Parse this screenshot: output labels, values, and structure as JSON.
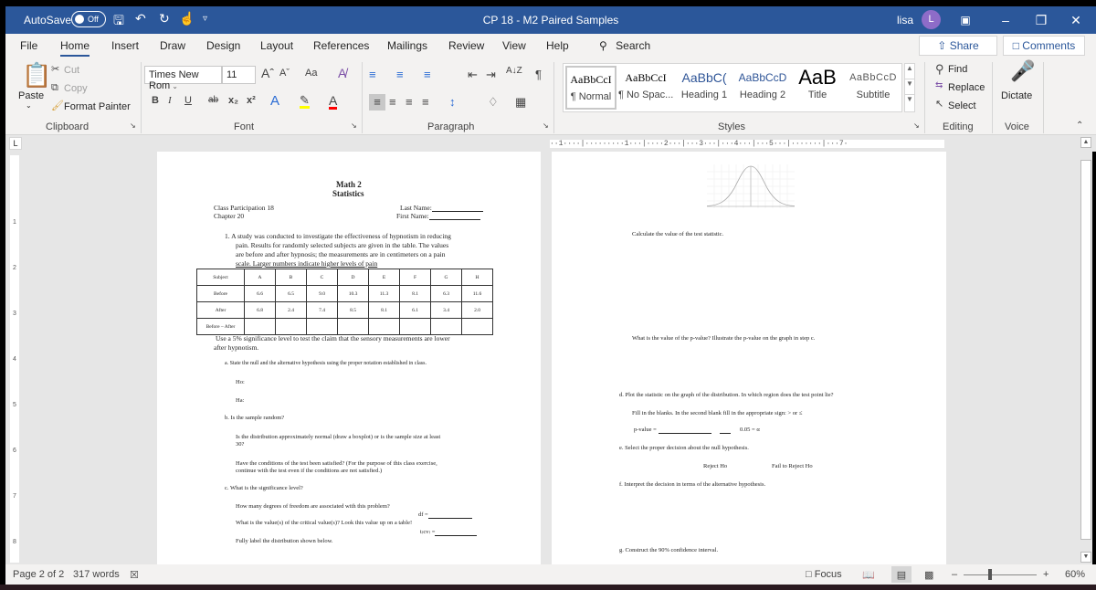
{
  "titlebar": {
    "autosave_label": "AutoSave",
    "autosave_state": "Off",
    "doc_title": "CP 18 - M2 Paired Samples",
    "user_name": "lisa",
    "user_initial": "L",
    "icons": [
      "save-icon",
      "undo-icon",
      "redo-icon",
      "touch-mode-icon",
      "customize-icon"
    ]
  },
  "menu": {
    "tabs": [
      "File",
      "Home",
      "Insert",
      "Draw",
      "Design",
      "Layout",
      "References",
      "Mailings",
      "Review",
      "View",
      "Help"
    ],
    "active_tab": "Home",
    "search_label": "Search",
    "share_label": "Share",
    "comments_label": "Comments"
  },
  "ribbon": {
    "clipboard": {
      "paste": "Paste",
      "cut": "Cut",
      "copy": "Copy",
      "format_painter": "Format Painter",
      "label": "Clipboard"
    },
    "font": {
      "font_name": "Times New Rom",
      "font_size": "11",
      "label": "Font",
      "grow": "Aˆ",
      "shrink": "Aˇ",
      "change_case": "Aa",
      "bold": "B",
      "italic": "I",
      "underline": "U",
      "strike": "ab",
      "subscript": "x₂",
      "superscript": "x²",
      "text_effects": "A",
      "font_color": "A",
      "highlight_color": "#ffff00",
      "font_color_value": "#ff0000"
    },
    "paragraph": {
      "label": "Paragraph",
      "pilcrow": "¶",
      "sort": "A↓Z"
    },
    "styles": {
      "label": "Styles",
      "items": [
        {
          "sample": "AaBbCcI",
          "name": "¶ Normal"
        },
        {
          "sample": "AaBbCcI",
          "name": "¶ No Spac..."
        },
        {
          "sample": "AaBbC(",
          "name": "Heading 1"
        },
        {
          "sample": "AaBbCcD",
          "name": "Heading 2"
        },
        {
          "sample": "AaB",
          "name": "Title"
        },
        {
          "sample": "AaBbCcD",
          "name": "Subtitle"
        }
      ]
    },
    "editing": {
      "label": "Editing",
      "find": "Find",
      "replace": "Replace",
      "select": "Select"
    },
    "voice": {
      "label": "Voice",
      "dictate": "Dictate"
    }
  },
  "ruler": {
    "horizontal": "··1····|·········1···|····2···|···3···|···4···|···5···|·······|···7·",
    "vertical_marks": [
      "1",
      "2",
      "3",
      "4",
      "5",
      "6",
      "7",
      "8"
    ]
  },
  "page1": {
    "course": "Math 2",
    "subject": "Statistics",
    "class_part": "Class Participation 18",
    "chapter": "Chapter 20",
    "last_name": "Last Name:",
    "first_name": "First Name:",
    "problem_lines": [
      "1. A study was conducted to investigate the effectiveness of hypnotism in reducing",
      "pain.  Results for randomly selected subjects are given in the table.  The values",
      "are before and after hypnosis; the measurements are in centimeters on a pain",
      "scale.  Larger numbers indicate higher levels of pain"
    ],
    "table": {
      "header": [
        "Subject",
        "A",
        "B",
        "C",
        "D",
        "E",
        "F",
        "G",
        "H"
      ],
      "rows": [
        [
          "Before",
          "6.6",
          "6.5",
          "9.0",
          "10.3",
          "11.3",
          "8.1",
          "6.3",
          "11.6"
        ],
        [
          "After",
          "6.8",
          "2.4",
          "7.4",
          "8.5",
          "8.1",
          "6.1",
          "3.4",
          "2.0"
        ],
        [
          "Before – After",
          "",
          "",
          "",
          "",
          "",
          "",
          "",
          ""
        ]
      ]
    },
    "claim_lines": [
      "Use a 5% significance level to test the claim that the sensory measurements are lower",
      "after hypnotism."
    ],
    "part_a": "a.   State the null and the alternative hypothesis using the proper notation established in class.",
    "ho": "Ho:",
    "ha": "Ha:",
    "part_b": "b.   Is the sample random?",
    "normal_q1": "Is the distribution approximately normal (draw a boxplot) or is the sample size at least",
    "normal_q2": "30?",
    "cond_q1": "Have the conditions of the test been satisfied?  (For the purpose of this class exercise,",
    "cond_q2": "continue with the test even if the conditions are not satisfied.)",
    "part_c": "c.   What is the significance level?",
    "df_q": "How many degrees of freedom are associated with this problem?",
    "df_label": "df =",
    "cv_q": "What is the value(s) of the critical value(s)?  Look this value up on a table!",
    "cv_label": "t₍cv₎ =",
    "label_dist": "Fully label the distribution shown below."
  },
  "page2": {
    "test_stat": "Calculate the value of the test statistic.",
    "p_value_q": "What is the value of the p-value?  Illustrate the p-value on the graph in step c.",
    "part_d": "d.   Plot the statistic on the graph of the distribution.  In which region does the test point lie?",
    "fill_blanks": "Fill in the blanks.  In the second blank fill in the appropriate sign:  > or ≤",
    "p_value_label": "p-value =",
    "alpha_label": "0.05 = α",
    "part_e": "e.   Select the proper decision about the null hypothesis.",
    "reject": "Reject Ho",
    "fail_reject": "Fail to Reject Ho",
    "part_f": "f.   Interpret the decision in terms of the alternative hypothesis.",
    "part_g": "g.   Construct the 90% confidence interval."
  },
  "status": {
    "page": "Page 2 of 2",
    "words": "317 words",
    "focus": "Focus",
    "zoom": "60%",
    "zoom_percent": 60
  }
}
